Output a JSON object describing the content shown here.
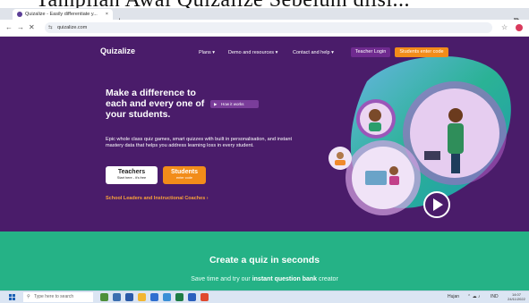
{
  "overlay_heading": "Tampilan Awal Quizalize Sebelum diisi...",
  "browser": {
    "tab_title": "Quizalize - Easily differentiate y...",
    "tab_close": "×",
    "new_tab": "+",
    "url": "quizalize.com",
    "window_min": "–",
    "window_restore": "⧉"
  },
  "site": {
    "logo": "Quizalize",
    "nav": {
      "plans": "Plans ▾",
      "demo": "Demo and resources ▾",
      "contact": "Contact and help ▾",
      "teacher_login": "Teacher Login",
      "students_code": "Students enter code"
    },
    "hero": {
      "title_line1": "Make a difference to",
      "title_line2": "each and every one of",
      "title_line3": "your students.",
      "how_it_works": "How it works",
      "body": "Epic whole class quiz games, smart quizzes with built in personalisation, and instant mastery data that helps you address learning loss in every student.",
      "teachers_label": "Teachers",
      "teachers_sub": "Start here - it's free",
      "students_label": "Students",
      "students_sub": "enter code",
      "leaders_link": "School Leaders and Instructional Coaches ›"
    },
    "section2": {
      "title": "Create a quiz in seconds",
      "sub_prefix": "Save time and try our ",
      "sub_bold": "instant question bank",
      "sub_suffix": " creator"
    }
  },
  "taskbar": {
    "search_placeholder": "Type here to search",
    "weather": "Hujan",
    "lang": "IND",
    "time": "14:07",
    "date": "24/11/2022"
  },
  "colors": {
    "site_bg": "#4a1c6a",
    "accent_orange": "#f28c1a",
    "green_section": "#25b286"
  }
}
